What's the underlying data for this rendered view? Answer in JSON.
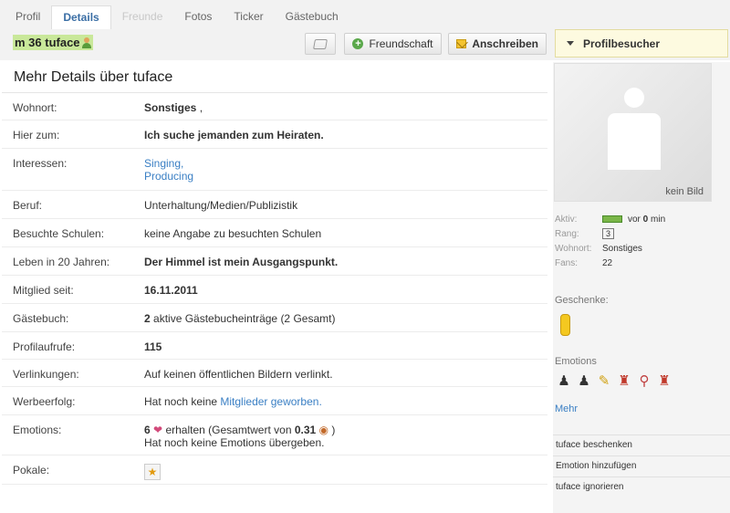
{
  "tabs": [
    {
      "label": "Profil",
      "state": "normal"
    },
    {
      "label": "Details",
      "state": "active"
    },
    {
      "label": "Freunde",
      "state": "disabled"
    },
    {
      "label": "Fotos",
      "state": "normal"
    },
    {
      "label": "Ticker",
      "state": "normal"
    },
    {
      "label": "Gästebuch",
      "state": "normal"
    }
  ],
  "user": {
    "title": "m 36 tuface"
  },
  "buttons": {
    "friend": "Freundschaft",
    "write": "Anschreiben",
    "visitors": "Profilbesucher"
  },
  "details": {
    "title": "Mehr Details über tuface",
    "rows": {
      "wohnort": {
        "label": "Wohnort:",
        "value": "Sonstiges",
        "suffix": " ,"
      },
      "hier": {
        "label": "Hier zum:",
        "value": "Ich suche jemanden zum Heiraten."
      },
      "interessen": {
        "label": "Interessen:",
        "value1": "Singing,",
        "value2": "Producing"
      },
      "beruf": {
        "label": "Beruf:",
        "value": "Unterhaltung/Medien/Publizistik"
      },
      "schulen": {
        "label": "Besuchte Schulen:",
        "value": "keine Angabe zu besuchten Schulen"
      },
      "leben": {
        "label": "Leben in 20 Jahren:",
        "value": "Der Himmel ist mein Ausgangspunkt."
      },
      "mitglied": {
        "label": "Mitglied seit:",
        "value": "16.11.2011"
      },
      "gaestebuch": {
        "label": "Gästebuch:",
        "count": "2",
        "value": " aktive Gästebucheinträge (2 Gesamt)"
      },
      "aufrufe": {
        "label": "Profilaufrufe:",
        "value": "115"
      },
      "verlinkungen": {
        "label": "Verlinkungen:",
        "value": "Auf keinen öffentlichen Bildern verlinkt."
      },
      "werbe": {
        "label": "Werbeerfolg:",
        "prefix": "Hat noch keine ",
        "link": "Mitglieder geworben."
      },
      "emotions": {
        "label": "Emotions:",
        "count": "6",
        "received": "erhalten (Gesamtwert von ",
        "total": "0.31",
        "close": " )",
        "line2": "Hat noch keine Emotions übergeben."
      },
      "pokale": {
        "label": "Pokale:"
      }
    }
  },
  "sidebar": {
    "avatar_label": "kein Bild",
    "stats": {
      "aktiv_label": "Aktiv:",
      "aktiv_prefix": "vor ",
      "aktiv_value": "0",
      "aktiv_unit": " min",
      "rang_label": "Rang:",
      "rang_value": "3",
      "wohnort_label": "Wohnort:",
      "wohnort_value": "Sonstiges",
      "fans_label": "Fans:",
      "fans_value": "22"
    },
    "geschenke": "Geschenke:",
    "emotions": "Emotions",
    "mehr": "Mehr",
    "actions": [
      "tuface beschenken",
      "Emotion hinzufügen",
      "tuface ignorieren"
    ]
  }
}
